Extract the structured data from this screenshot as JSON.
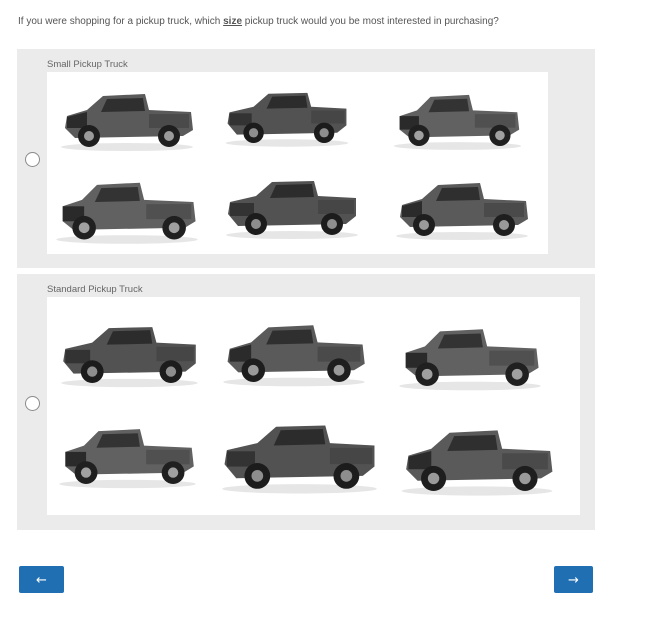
{
  "question": {
    "prefix": "If you were shopping for a pickup truck, which ",
    "keyword": "size",
    "suffix": " pickup truck would you be most interested in purchasing?"
  },
  "options": [
    {
      "label": "Small Pickup Truck",
      "selected": false
    },
    {
      "label": "Standard Pickup Truck",
      "selected": false
    }
  ],
  "nav": {
    "back_label": "←",
    "next_label": "→"
  },
  "colors": {
    "button": "#1f6fb2",
    "panel": "#ebebeb",
    "truck_body": "#5a5a5a",
    "truck_dark": "#2b2b2b"
  }
}
